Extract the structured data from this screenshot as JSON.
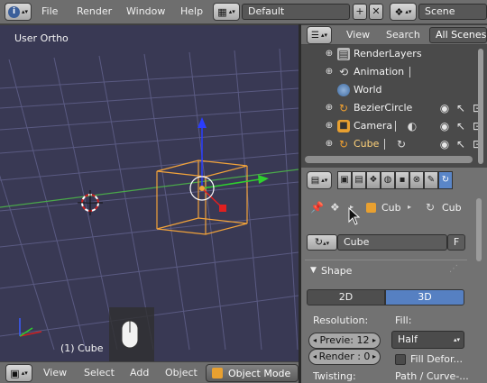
{
  "topbar": {
    "info_icon": "info-icon",
    "menus": [
      "File",
      "Render",
      "Window",
      "Help"
    ],
    "screen_layout": "Default",
    "scene": "Scene"
  },
  "viewport": {
    "view_label": "User Ortho",
    "object_label": "(1) Cube",
    "colors": {
      "background": "#393954",
      "grid": "#55557a",
      "x_axis": "#44aa44",
      "object": "#f0a030"
    }
  },
  "viewport_header": {
    "menus": [
      "View",
      "Select",
      "Add",
      "Object"
    ],
    "mode": "Object Mode"
  },
  "outliner": {
    "header": {
      "view": "View",
      "search": "Search",
      "display_mode": "All Scenes"
    },
    "items": [
      {
        "label": "RenderLayers",
        "icon": "renderlayers-icon"
      },
      {
        "label": "Animation",
        "icon": "animation-icon"
      },
      {
        "label": "World",
        "icon": "world-icon"
      },
      {
        "label": "BezierCircle",
        "icon": "curve-icon"
      },
      {
        "label": "Camera",
        "icon": "camera-icon"
      },
      {
        "label": "Cube",
        "icon": "curve-icon"
      }
    ]
  },
  "properties": {
    "breadcrumb": {
      "object": "Cub",
      "data": "Cub"
    },
    "datablock": {
      "name": "Cube",
      "fake_user": "F"
    },
    "shape_panel": {
      "title": "Shape",
      "dimension_2d": "2D",
      "dimension_3d": "3D",
      "resolution_label": "Resolution:",
      "fill_label": "Fill:",
      "preview_field": "Previe: 12",
      "render_field": "Render : 0",
      "fill_value": "Half",
      "fill_deform": "Fill Defor...",
      "twisting_label": "Twisting:",
      "path_curve": "Path / Curve-..."
    }
  }
}
